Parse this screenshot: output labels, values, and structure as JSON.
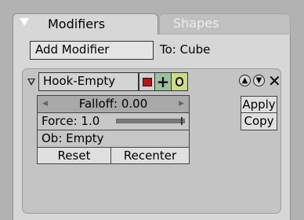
{
  "tabs": [
    {
      "label": "Modifiers",
      "active": true
    },
    {
      "label": "Shapes",
      "active": false
    }
  ],
  "toolbar": {
    "add_modifier_label": "Add Modifier",
    "target_label": "To: Cube"
  },
  "modifier": {
    "name": "Hook-Empty",
    "falloff_label": "Falloff: 0.00",
    "force_label": "Force: 1.0",
    "force_value": 1.0,
    "object_label": "Ob: Empty",
    "reset_label": "Reset",
    "recenter_label": "Recenter",
    "apply_label": "Apply",
    "copy_label": "Copy"
  },
  "colors": {
    "panel": "#d7d7d7",
    "background": "#b2b2b2",
    "accent_render": "#b01818"
  }
}
